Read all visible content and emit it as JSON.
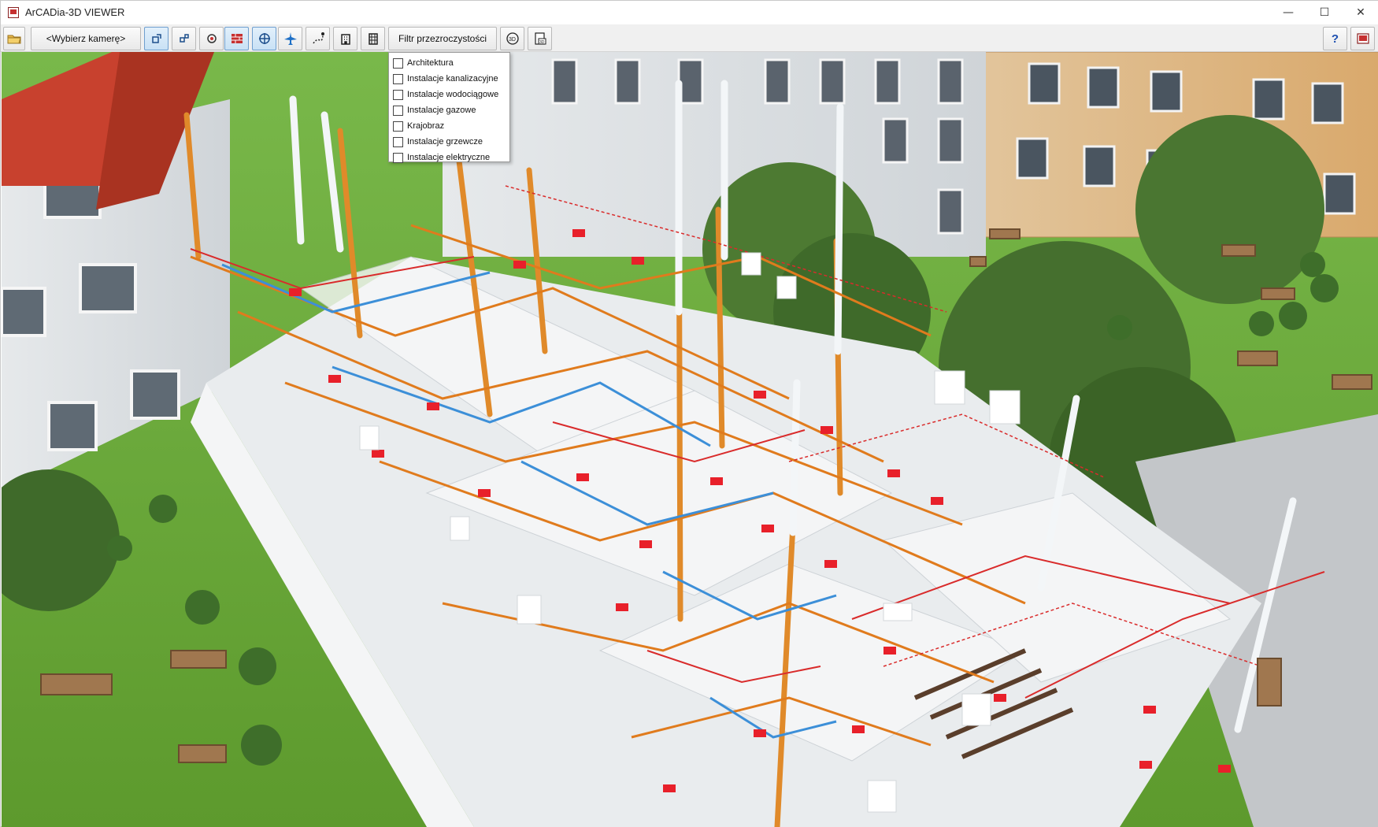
{
  "window": {
    "title": "ArCADia-3D VIEWER",
    "controls": {
      "minimize": "—",
      "maximize": "☐",
      "close": "✕"
    }
  },
  "toolbar": {
    "camera_select_label": "<Wybierz kamerę>",
    "transparency_filter_label": "Filtr przezroczystości",
    "help_label": "?",
    "icons": [
      "open-folder-icon",
      "camera-orbit-icon",
      "camera-pan-icon",
      "camera-look-icon",
      "wall-icon",
      "walk-icon",
      "fly-icon",
      "path-icon",
      "building-section-icon",
      "building-floors-icon",
      "3d-rotate-icon",
      "export-image-icon",
      "help-icon",
      "app-logo-icon"
    ]
  },
  "transparency_filter": {
    "items": [
      {
        "label": "Architektura",
        "checked": false
      },
      {
        "label": "Instalacje kanalizacyjne",
        "checked": false
      },
      {
        "label": "Instalacje wodociągowe",
        "checked": false
      },
      {
        "label": "Instalacje gazowe",
        "checked": false
      },
      {
        "label": "Krajobraz",
        "checked": false
      },
      {
        "label": "Instalacje grzewcze",
        "checked": false
      },
      {
        "label": "Instalacje elektryczne",
        "checked": false
      }
    ]
  },
  "colors": {
    "grass": "#6fae3a",
    "roof": "#c8412e",
    "facade": "#dfe3e6",
    "pipe_hot": "#e07b1d",
    "pipe_cold": "#3c8fd8",
    "pipe_red": "#d92b2b",
    "toolbar_active": "#c9e1f5"
  }
}
